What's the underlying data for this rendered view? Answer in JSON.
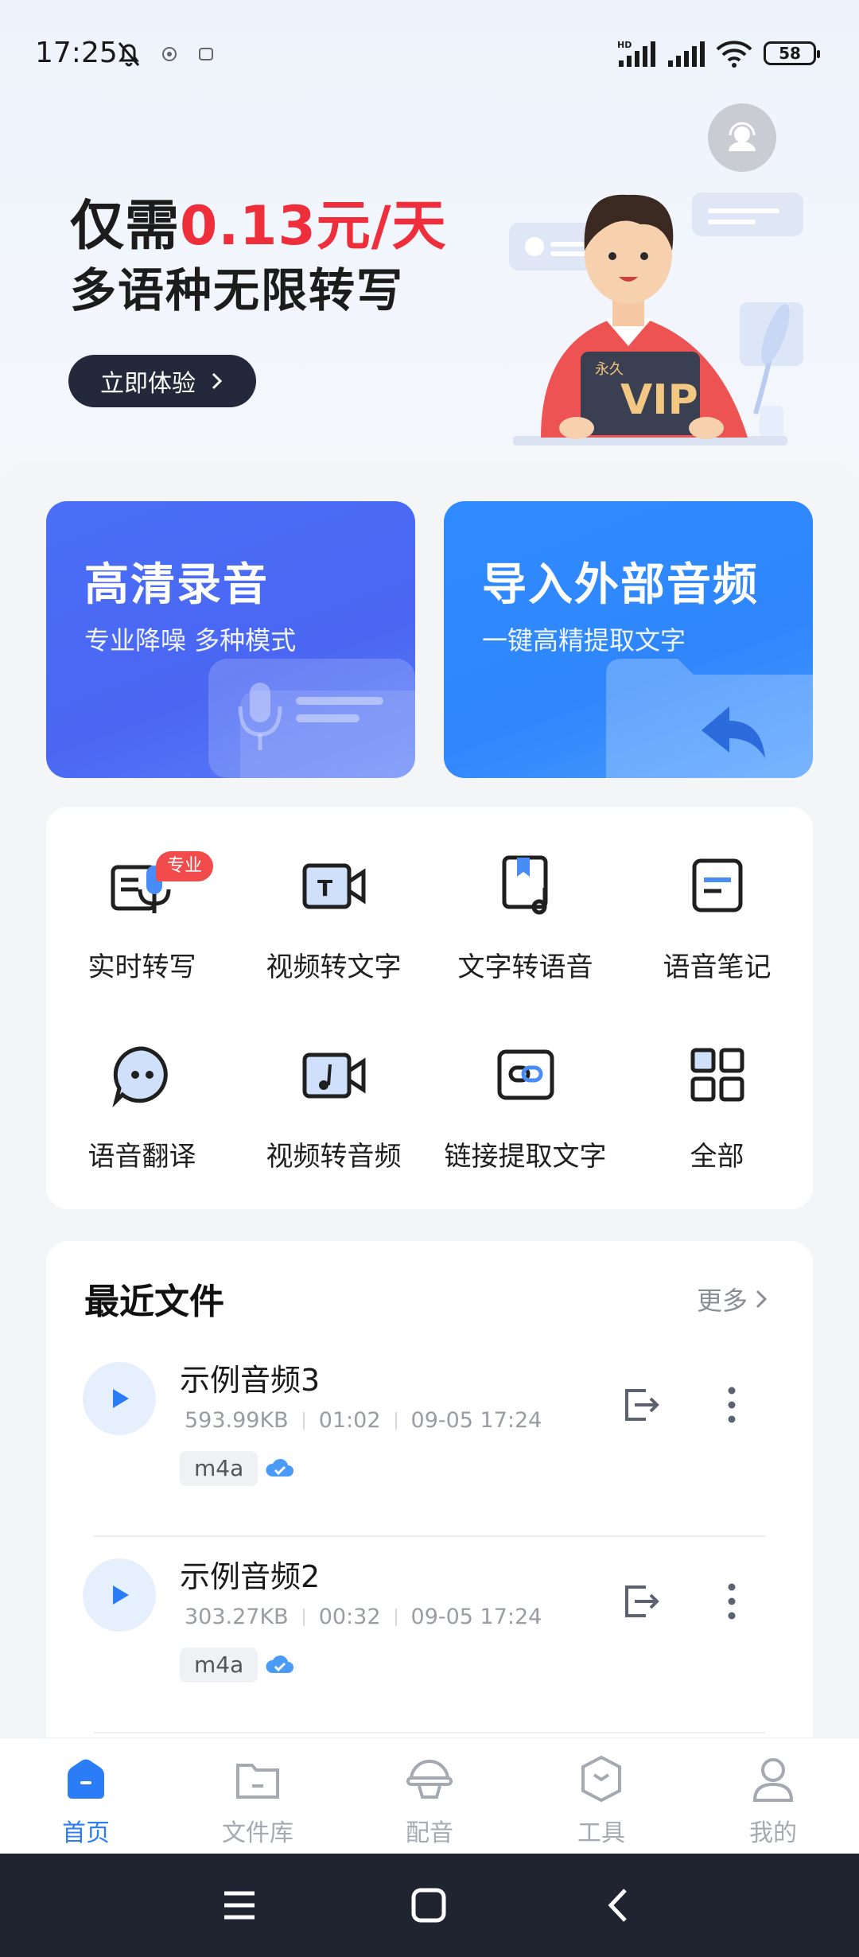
{
  "status_bar": {
    "time": "17:25",
    "battery": "58"
  },
  "promo": {
    "line1_prefix": "仅需",
    "line1_highlight": "0.13元/天",
    "line2": "多语种无限转写",
    "button": "立即体验",
    "vip_small": "永久",
    "vip_big": "VIP"
  },
  "feature_cards": [
    {
      "title": "高清录音",
      "subtitle": "专业降噪 多种模式"
    },
    {
      "title": "导入外部音频",
      "subtitle": "一键高精提取文字"
    }
  ],
  "tools": {
    "badge": "专业",
    "items": [
      {
        "label": "实时转写",
        "icon": "realtime-transcribe-icon"
      },
      {
        "label": "视频转文字",
        "icon": "video-to-text-icon"
      },
      {
        "label": "文字转语音",
        "icon": "text-to-speech-icon"
      },
      {
        "label": "语音笔记",
        "icon": "voice-note-icon"
      },
      {
        "label": "语音翻译",
        "icon": "voice-translate-icon"
      },
      {
        "label": "视频转音频",
        "icon": "video-to-audio-icon"
      },
      {
        "label": "链接提取文字",
        "icon": "link-extract-icon"
      },
      {
        "label": "全部",
        "icon": "grid-icon"
      }
    ]
  },
  "recent": {
    "title": "最近文件",
    "more": "更多",
    "files": [
      {
        "name": "示例音频3",
        "size": "593.99KB",
        "duration": "01:02",
        "date": "09-05 17:24",
        "format": "m4a"
      },
      {
        "name": "示例音频2",
        "size": "303.27KB",
        "duration": "00:32",
        "date": "09-05 17:24",
        "format": "m4a"
      }
    ]
  },
  "tab_bar": [
    {
      "label": "首页",
      "icon": "home-icon",
      "active": true
    },
    {
      "label": "文件库",
      "icon": "folder-icon",
      "active": false
    },
    {
      "label": "配音",
      "icon": "dubbing-icon",
      "active": false
    },
    {
      "label": "工具",
      "icon": "toolbox-icon",
      "active": false
    },
    {
      "label": "我的",
      "icon": "profile-icon",
      "active": false
    }
  ],
  "colors": {
    "accent": "#2b7cf7",
    "highlight": "#ee2f3b",
    "dark_button": "#23293a"
  }
}
